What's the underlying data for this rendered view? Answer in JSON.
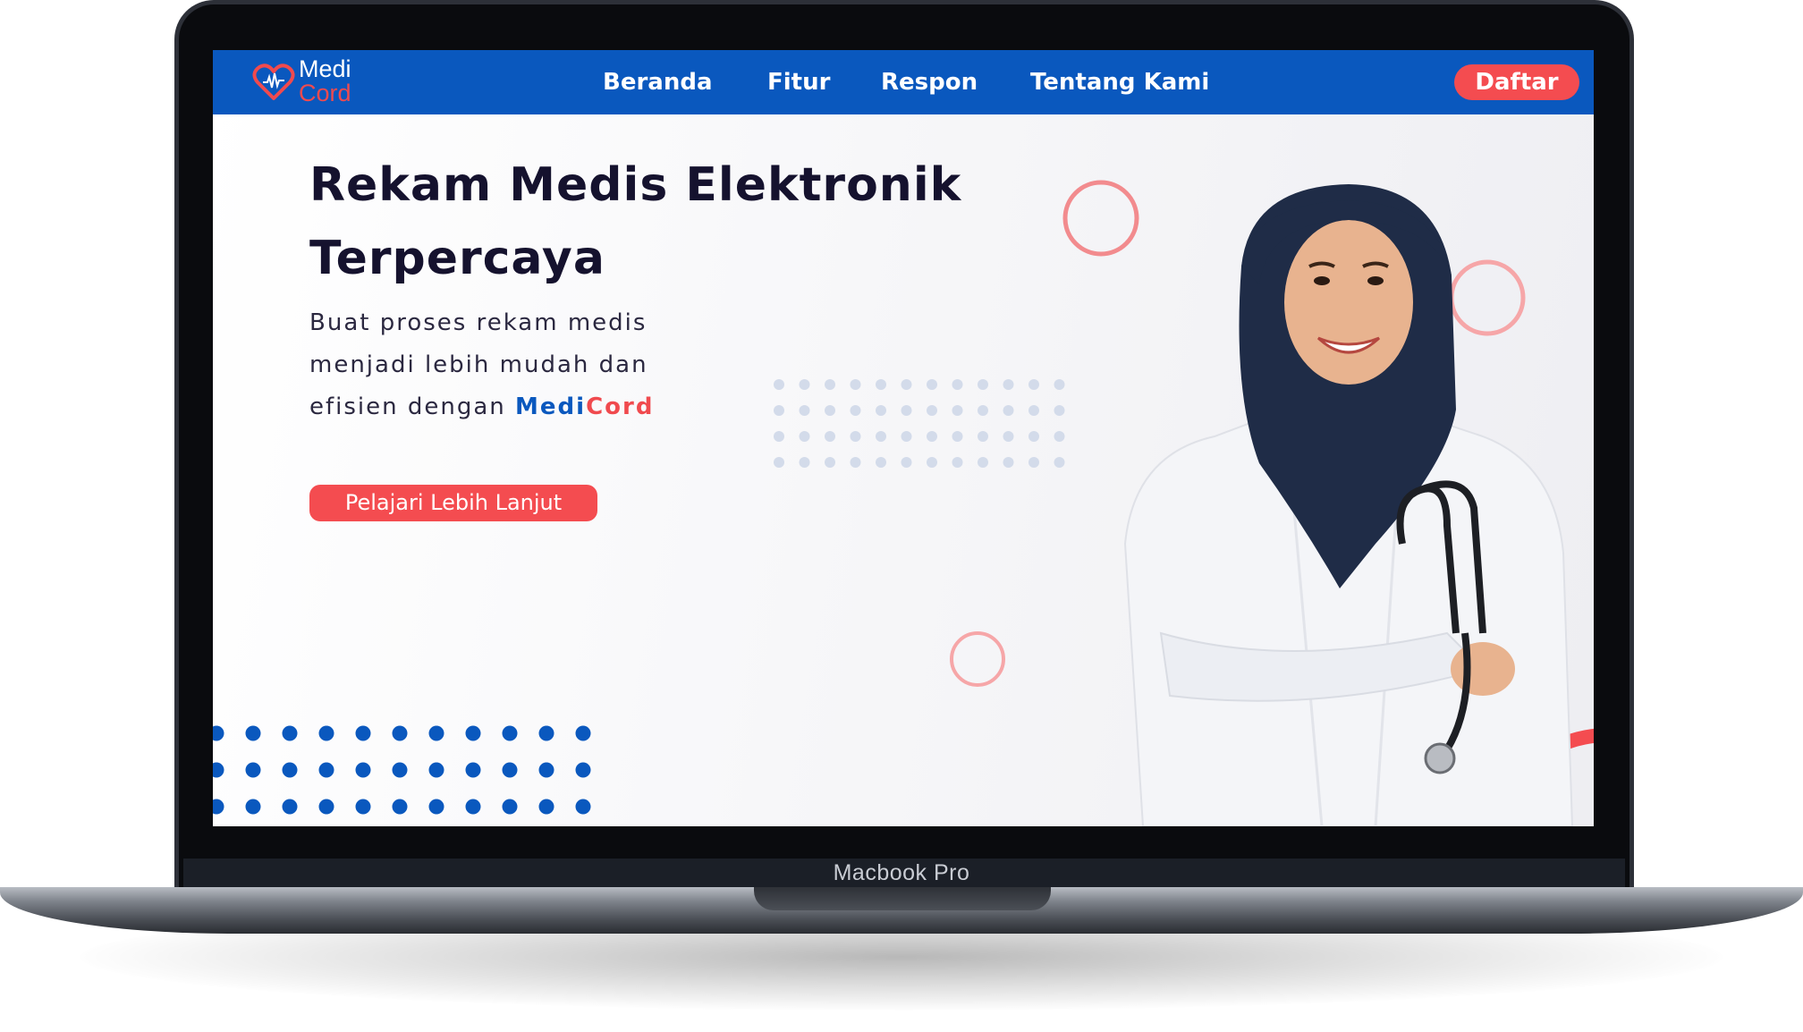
{
  "device": {
    "label": "Macbook Pro"
  },
  "brand": {
    "name_line1": "Medi",
    "name_line2": "Cord",
    "primary_color": "#0a58be",
    "accent_color": "#f44c50"
  },
  "nav": {
    "items": [
      {
        "label": "Beranda"
      },
      {
        "label": "Fitur"
      },
      {
        "label": "Respon"
      },
      {
        "label": "Tentang Kami"
      }
    ],
    "cta_label": "Daftar"
  },
  "hero": {
    "title_line1": "Rekam Medis Elektronik",
    "title_line2": "Terpercaya",
    "subtitle_line1": "Buat proses rekam medis",
    "subtitle_line2": "menjadi lebih mudah dan",
    "subtitle_line3_prefix": "efisien dengan ",
    "subtitle_brand_a": "Medi",
    "subtitle_brand_b": "Cord",
    "cta_label": "Pelajari Lebih Lanjut"
  },
  "icons": {
    "logo": "heart-pulse-icon"
  }
}
